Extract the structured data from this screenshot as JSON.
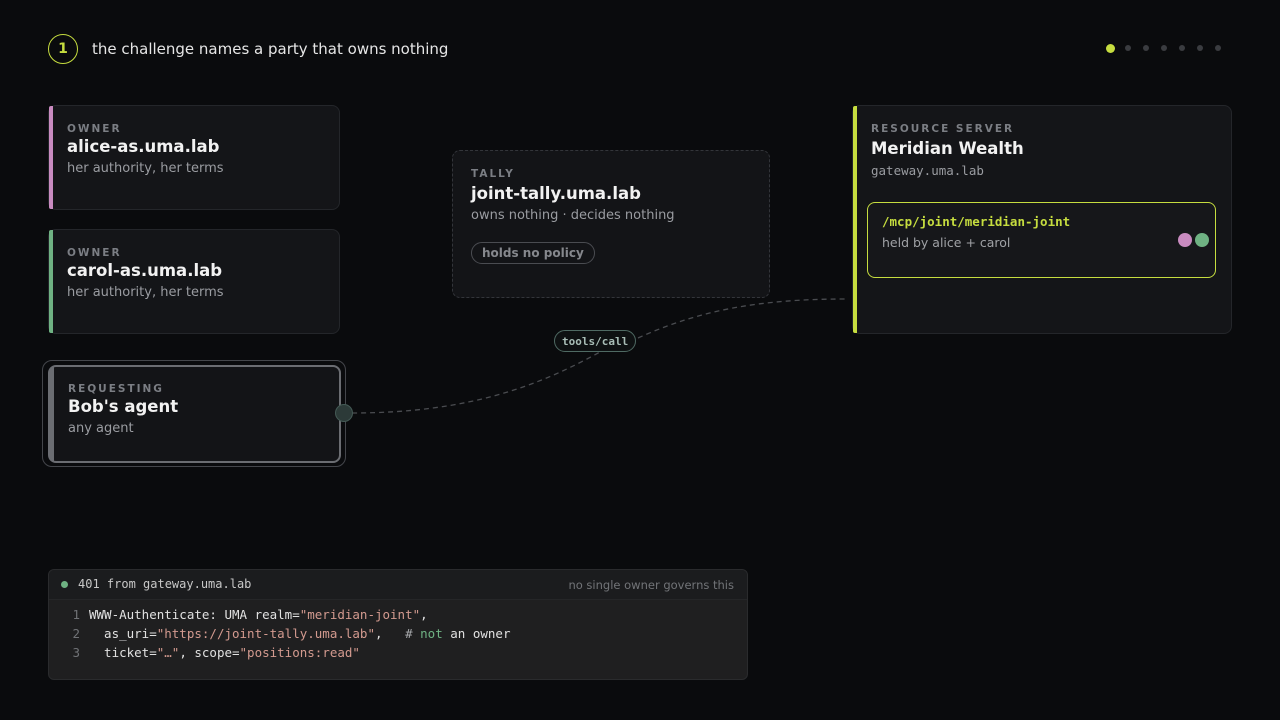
{
  "header": {
    "step_number": "1",
    "title": "the challenge names a party that owns nothing",
    "progress": {
      "current": 1,
      "total": 7
    }
  },
  "colors": {
    "accent": "#c6dd3f",
    "alice": "#c98bc0",
    "carol": "#6fb283",
    "requesting": "#6b6d72"
  },
  "owners": [
    {
      "kicker": "OWNER",
      "name": "alice-as.uma.lab",
      "subtitle": "her authority, her terms"
    },
    {
      "kicker": "OWNER",
      "name": "carol-as.uma.lab",
      "subtitle": "her authority, her terms"
    }
  ],
  "requesting": {
    "kicker": "REQUESTING",
    "name": "Bob's agent",
    "subtitle": "any agent"
  },
  "tally": {
    "kicker": "TALLY",
    "name": "joint-tally.uma.lab",
    "subtitle": "owns nothing · decides nothing",
    "pill": "holds no policy"
  },
  "resource_server": {
    "kicker": "RESOURCE SERVER",
    "name": "Meridian Wealth",
    "host": "gateway.uma.lab",
    "endpoint": {
      "path": "/mcp/joint/meridian-joint",
      "held_by": "held by alice + carol"
    }
  },
  "edge": {
    "label": "tools/call"
  },
  "console": {
    "status": "401 from gateway.uma.lab",
    "note": "no single owner governs this",
    "lines": [
      {
        "n": "1",
        "a": "WWW-Authenticate: UMA realm=",
        "b": "\"meridian-joint\"",
        "c": ","
      },
      {
        "n": "2",
        "a": "  as_uri=",
        "b": "\"https://joint-tally.uma.lab\"",
        "c": ",   ",
        "d": "# ",
        "e": "not",
        "f": " an owner"
      },
      {
        "n": "3",
        "a": "  ticket=",
        "b": "\"…\"",
        "c": ", scope=",
        "d": "\"positions:read\""
      }
    ]
  }
}
